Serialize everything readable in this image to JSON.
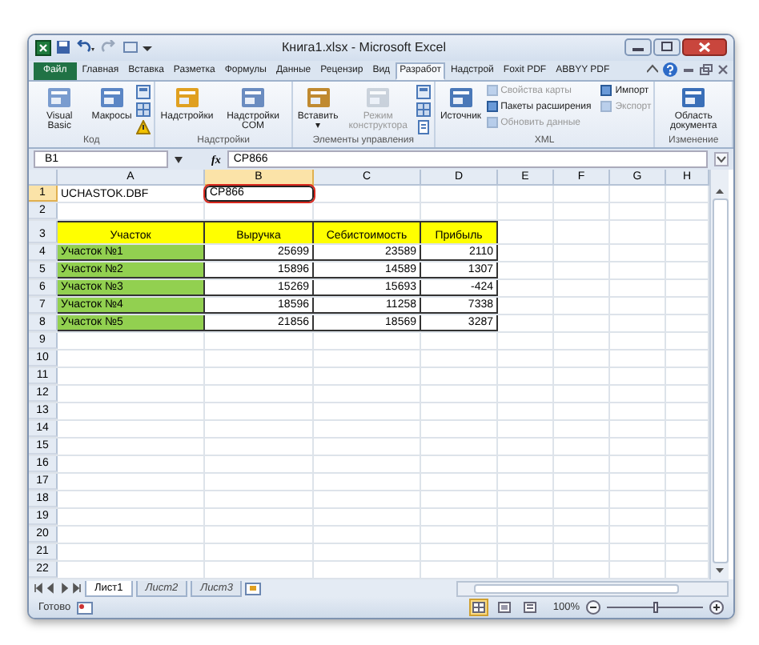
{
  "window": {
    "title": "Книга1.xlsx - Microsoft Excel"
  },
  "tabs": [
    {
      "label": "Файл",
      "kind": "file",
      "selected": false
    },
    {
      "label": "Главная",
      "kind": "tab",
      "selected": false
    },
    {
      "label": "Вставка",
      "kind": "tab",
      "selected": false
    },
    {
      "label": "Разметка",
      "kind": "tab",
      "selected": false
    },
    {
      "label": "Формулы",
      "kind": "tab",
      "selected": false
    },
    {
      "label": "Данные",
      "kind": "tab",
      "selected": false
    },
    {
      "label": "Рецензир",
      "kind": "tab",
      "selected": false
    },
    {
      "label": "Вид",
      "kind": "tab",
      "selected": false
    },
    {
      "label": "Разработ",
      "kind": "tab",
      "selected": true
    },
    {
      "label": "Надстрой",
      "kind": "tab",
      "selected": false
    },
    {
      "label": "Foxit PDF",
      "kind": "tab",
      "selected": false
    },
    {
      "label": "ABBYY PDF",
      "kind": "tab",
      "selected": false
    }
  ],
  "ribbon": [
    {
      "label": "Код",
      "items": [
        {
          "label": "Visual Basic",
          "kind": "large",
          "disabled": false
        },
        {
          "label": "Макросы",
          "kind": "large",
          "disabled": false
        }
      ]
    },
    {
      "label": "Надстройки",
      "items": [
        {
          "label": "Надстройки",
          "kind": "large",
          "disabled": false
        },
        {
          "label": "Надстройки COM",
          "kind": "large",
          "disabled": false
        }
      ]
    },
    {
      "label": "Элементы управления",
      "items": [
        {
          "label": "Вставить",
          "kind": "large",
          "disabled": false,
          "caret": "▾"
        },
        {
          "label": "Режим конструктора",
          "kind": "large",
          "disabled": true
        }
      ]
    },
    {
      "label": "XML",
      "items": [
        {
          "label": "Источник",
          "kind": "large",
          "disabled": false
        },
        {
          "label": "Свойства карты",
          "kind": "small",
          "disabled": true
        },
        {
          "label": "Пакеты расширения",
          "kind": "small",
          "disabled": false
        },
        {
          "label": "Обновить данные",
          "kind": "small",
          "disabled": true
        },
        {
          "label": "Импорт",
          "kind": "small",
          "disabled": false
        },
        {
          "label": "Экспорт",
          "kind": "small",
          "disabled": true
        }
      ]
    },
    {
      "label": "Изменение",
      "items": [
        {
          "label": "Область документа",
          "kind": "large",
          "disabled": false
        }
      ]
    }
  ],
  "formula_bar": {
    "name_box": "B1",
    "function_label": "fx",
    "value": "CP866"
  },
  "columns": [
    "A",
    "B",
    "C",
    "D",
    "E",
    "F",
    "G",
    "H"
  ],
  "rows": [
    {
      "number": "1",
      "cells": [
        {
          "text": "UCHASTOK.DBF",
          "kind": "plain",
          "selected": false
        },
        {
          "text": "CP866",
          "kind": "plain",
          "selected": true,
          "highlighted": true
        }
      ]
    },
    {
      "number": "2",
      "cells": []
    },
    {
      "number": "3",
      "cells": [
        {
          "text": "Участок",
          "kind": "heading",
          "color": "#ffff00",
          "selected": false
        },
        {
          "text": "Выручка",
          "kind": "heading",
          "color": "#ffff00",
          "selected": false
        },
        {
          "text": "Себистоимость",
          "kind": "heading",
          "color": "#ffff00",
          "selected": false
        },
        {
          "text": "Прибыль",
          "kind": "heading",
          "color": "#ffff00",
          "selected": false
        }
      ]
    },
    {
      "number": "4",
      "cells": [
        {
          "text": "Участок №1",
          "kind": "label",
          "color": "#92d050",
          "selected": false
        },
        {
          "text": "25699",
          "kind": "number",
          "selected": false
        },
        {
          "text": "23589",
          "kind": "number",
          "selected": false
        },
        {
          "text": "2110",
          "kind": "number",
          "selected": false
        }
      ]
    },
    {
      "number": "5",
      "cells": [
        {
          "text": "Участок №2",
          "kind": "label",
          "color": "#92d050",
          "selected": false
        },
        {
          "text": "15896",
          "kind": "number",
          "selected": false
        },
        {
          "text": "14589",
          "kind": "number",
          "selected": false
        },
        {
          "text": "1307",
          "kind": "number",
          "selected": false
        }
      ]
    },
    {
      "number": "6",
      "cells": [
        {
          "text": "Участок №3",
          "kind": "label",
          "color": "#92d050",
          "selected": false
        },
        {
          "text": "15269",
          "kind": "number",
          "selected": false
        },
        {
          "text": "15693",
          "kind": "number",
          "selected": false
        },
        {
          "text": "-424",
          "kind": "number",
          "selected": false
        }
      ]
    },
    {
      "number": "7",
      "cells": [
        {
          "text": "Участок №4",
          "kind": "label",
          "color": "#92d050",
          "selected": false
        },
        {
          "text": "18596",
          "kind": "number",
          "selected": false
        },
        {
          "text": "11258",
          "kind": "number",
          "selected": false
        },
        {
          "text": "7338",
          "kind": "number",
          "selected": false
        }
      ]
    },
    {
      "number": "8",
      "cells": [
        {
          "text": "Участок №5",
          "kind": "label",
          "color": "#92d050",
          "selected": false
        },
        {
          "text": "21856",
          "kind": "number",
          "selected": false
        },
        {
          "text": "18569",
          "kind": "number",
          "selected": false
        },
        {
          "text": "3287",
          "kind": "number",
          "selected": false
        }
      ]
    },
    {
      "number": "9",
      "cells": []
    },
    {
      "number": "10",
      "cells": []
    },
    {
      "number": "11",
      "cells": []
    },
    {
      "number": "12",
      "cells": []
    },
    {
      "number": "13",
      "cells": []
    },
    {
      "number": "14",
      "cells": []
    },
    {
      "number": "15",
      "cells": []
    },
    {
      "number": "16",
      "cells": []
    },
    {
      "number": "17",
      "cells": []
    },
    {
      "number": "18",
      "cells": []
    },
    {
      "number": "19",
      "cells": []
    },
    {
      "number": "20",
      "cells": []
    },
    {
      "number": "21",
      "cells": []
    },
    {
      "number": "22",
      "cells": []
    }
  ],
  "sheet_tabs": [
    {
      "label": "Лист1",
      "selected": true
    },
    {
      "label": "Лист2",
      "selected": false
    },
    {
      "label": "Лист3",
      "selected": false
    }
  ],
  "status_bar": {
    "text": "Готово",
    "views": [
      {
        "selected": true
      },
      {
        "selected": false
      },
      {
        "selected": false
      }
    ],
    "zoom": "100%",
    "zoom_level": {
      "level": 0.5
    }
  }
}
